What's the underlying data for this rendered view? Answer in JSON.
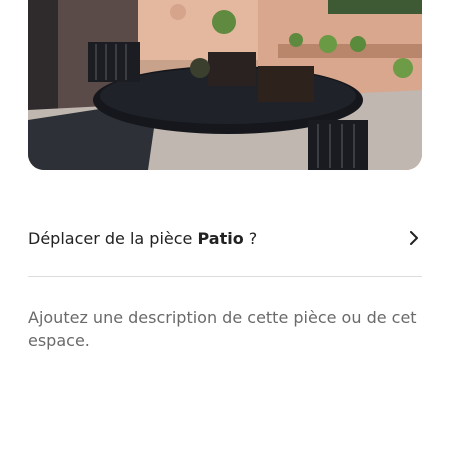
{
  "photo": {
    "alt": "Patio"
  },
  "move_room": {
    "prefix": "Déplacer de la pièce ",
    "room": "Patio",
    "suffix": " ?",
    "icon": "chevron-right-icon"
  },
  "description": {
    "placeholder": "Ajoutez une description de cette pièce ou de cet espace."
  },
  "colors": {
    "text_primary": "#222222",
    "text_secondary": "#6a6a6a",
    "divider": "#dddddd"
  }
}
